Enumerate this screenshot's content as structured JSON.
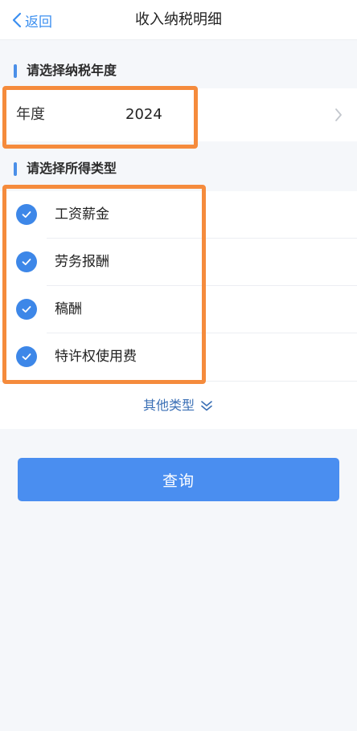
{
  "nav": {
    "back_label": "返回",
    "title": "收入纳税明细"
  },
  "year_section": {
    "header": "请选择纳税年度",
    "label": "年度",
    "value": "2024"
  },
  "type_section": {
    "header": "请选择所得类型",
    "items": [
      {
        "label": "工资薪金",
        "checked": true
      },
      {
        "label": "劳务报酬",
        "checked": true
      },
      {
        "label": "稿酬",
        "checked": true
      },
      {
        "label": "特许权使用费",
        "checked": true
      }
    ],
    "more_label": "其他类型"
  },
  "query_button": "查询",
  "colors": {
    "accent": "#4a8ef0",
    "check": "#3d87e8",
    "highlight": "#f58b3c",
    "background": "#f5f7fa"
  },
  "icons": {
    "back": "chevron-left-icon",
    "year_arrow": "chevron-right-icon",
    "check": "check-circle-icon",
    "more": "double-chevron-down-icon"
  }
}
